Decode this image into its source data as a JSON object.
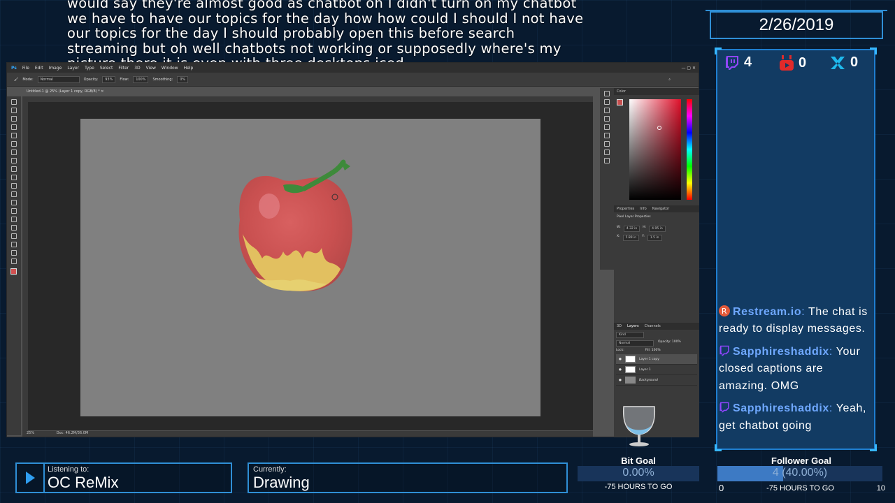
{
  "captions": {
    "lines": [
      "would say they're almost good as chatbot oh I didn't turn on my chatbot",
      "we have to have our topics for the day how how could I should I not have",
      "our topics for the day I should probably open this before search",
      "streaming but oh well chatbots not working or supposedly where's my",
      "picture there it is even with three desktops iced"
    ]
  },
  "date": "2/26/2019",
  "counters": {
    "twitch": "4",
    "youtube": "0",
    "mixer": "0"
  },
  "chat": [
    {
      "user": "Restream.io",
      "separator": ":",
      "text": "The chat is ready to display messages.",
      "badge": "restream-icon"
    },
    {
      "user": "Sapphireshaddix",
      "separator": ":",
      "text": "Your closed captions are amazing. OMG",
      "badge": "twitch-icon"
    },
    {
      "user": "Sapphireshaddix",
      "separator": ":",
      "text": "Yeah, get chatbot going",
      "badge": "twitch-icon"
    }
  ],
  "photoshop": {
    "menu": [
      "Ps",
      "File",
      "Edit",
      "Image",
      "Layer",
      "Type",
      "Select",
      "Filter",
      "3D",
      "View",
      "Window",
      "Help"
    ],
    "options": {
      "mode_label": "Mode:",
      "mode_value": "Normal",
      "opacity_label": "Opacity:",
      "opacity_value": "93%",
      "flow_label": "Flow:",
      "flow_value": "100%",
      "smoothing_label": "Smoothing:",
      "smoothing_value": "0%"
    },
    "doc_tab": "Untitled-1 @ 25% (Layer 1 copy, RGB/8) *",
    "status_zoom": "25%",
    "status_doc": "Doc: 46.2M/36.0M",
    "color_panel_title": "Color",
    "properties_tabs": [
      "Properties",
      "Info",
      "Navigator"
    ],
    "properties_title": "Pixel Layer Properties",
    "properties": {
      "w_label": "W:",
      "w": "4.32 in",
      "h_label": "H:",
      "h": "4.95 in",
      "x_label": "X:",
      "x": "5.89 in",
      "y_label": "Y:",
      "y": "1.5 in"
    },
    "layers_tabs": [
      "3D",
      "Layers",
      "Channels"
    ],
    "layers_kind": "Kind",
    "blend_mode": "Normal",
    "layers_opacity": "Opacity: 100%",
    "layers_lock": "Lock:",
    "layers_fill": "Fill: 100%",
    "layers": [
      "Layer 1 copy",
      "Layer 1",
      "Background"
    ]
  },
  "listening": {
    "label": "Listening to:",
    "value": "OC ReMix"
  },
  "currently": {
    "label": "Currently:",
    "value": "Drawing"
  },
  "bit_goal": {
    "title": "Bit Goal",
    "percent_text": "0.00%",
    "fraction": 0.0,
    "subtext": "-75 HOURS TO GO"
  },
  "follower_goal": {
    "title": "Follower Goal",
    "bar_text": "4 (40.00%)",
    "fraction": 0.4,
    "min": "0",
    "max": "10",
    "subtext": "-75 HOURS TO GO"
  }
}
